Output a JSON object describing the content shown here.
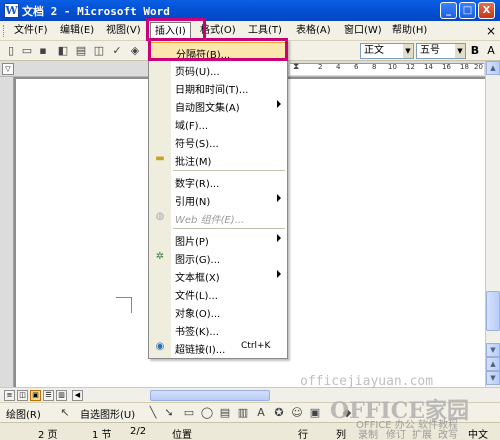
{
  "window": {
    "title": "文档 2 - Microsoft Word",
    "app_icon": "W",
    "min": "_",
    "max": "□",
    "close": "X"
  },
  "menubar": {
    "items": [
      "文件(F)",
      "编辑(E)",
      "视图(V)",
      "插入(I)",
      "格式(O)",
      "工具(T)",
      "表格(A)",
      "窗口(W)",
      "帮助(H)"
    ],
    "active_index": 3,
    "close_doc": "×"
  },
  "toolbar": {
    "style_value": "正文",
    "size_value": "五号",
    "bold": "B",
    "size_arrow": "A"
  },
  "ruler": {
    "numbers": [
      "2",
      "4",
      "6",
      "8",
      "10",
      "12",
      "14",
      "16",
      "18",
      "20"
    ]
  },
  "insert_menu": {
    "items": [
      {
        "label": "分隔符(B)...",
        "selected": true
      },
      {
        "label": "页码(U)..."
      },
      {
        "label": "日期和时间(T)..."
      },
      {
        "label": "自动图文集(A)",
        "submenu": true
      },
      {
        "label": "域(F)..."
      },
      {
        "label": "符号(S)..."
      },
      {
        "label": "批注(M)",
        "icon": "comment-icon"
      },
      {
        "label": "数字(R)..."
      },
      {
        "label": "引用(N)",
        "submenu": true
      },
      {
        "label": "Web 组件(E)...",
        "disabled": true,
        "icon": "web-component-icon"
      },
      {
        "label": "图片(P)",
        "submenu": true
      },
      {
        "label": "图示(G)...",
        "icon": "diagram-icon"
      },
      {
        "label": "文本框(X)",
        "submenu": true
      },
      {
        "label": "文件(L)..."
      },
      {
        "label": "对象(O)..."
      },
      {
        "label": "书签(K)..."
      },
      {
        "label": "超链接(I)...",
        "shortcut": "Ctrl+K",
        "icon": "hyperlink-icon"
      }
    ]
  },
  "drawbar": {
    "draw_label": "绘图(R)",
    "autoshapes_label": "自选图形(U)"
  },
  "statusbar": {
    "page": "2 页",
    "section": "1 节",
    "pages": "2/2",
    "position": "位置",
    "line": "行",
    "col": "列",
    "rec": "录制",
    "trk": "修订",
    "ext": "扩展",
    "ovr": "改写",
    "lang": "中文"
  },
  "watermark": {
    "url": "officejiayuan.com",
    "brand": "OFFICE家园",
    "tagline": "OFFICE 办公 软件教程"
  }
}
